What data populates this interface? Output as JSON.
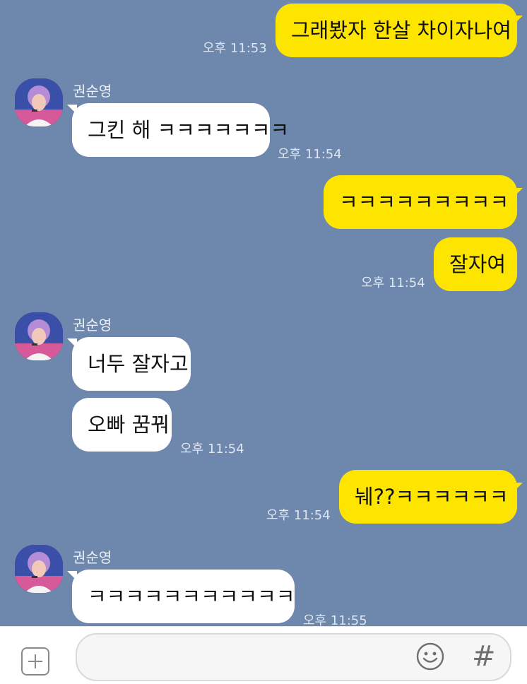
{
  "colors": {
    "background": "#6d87ad",
    "my_bubble": "#fde500",
    "their_bubble": "#ffffff"
  },
  "messages": [
    {
      "sender": "me",
      "text": "그래봤자 한살 차이자나여",
      "time": "오후 11:53"
    },
    {
      "sender": "권순영",
      "text": "그킨 해 ㅋㅋㅋㅋㅋㅋㅋ",
      "time": "오후 11:54"
    },
    {
      "sender": "me",
      "text": "ㅋㅋㅋㅋㅋㅋㅋㅋㅋ"
    },
    {
      "sender": "me",
      "text": "잘자여",
      "time": "오후 11:54"
    },
    {
      "sender": "권순영",
      "text": "너두 잘자고"
    },
    {
      "sender": "권순영",
      "text": "오빠 꿈꿔",
      "time": "오후 11:54"
    },
    {
      "sender": "me",
      "text": "눼??ㅋㅋㅋㅋㅋㅋ",
      "time": "오후 11:54"
    },
    {
      "sender": "권순영",
      "text": "ㅋㅋㅋㅋㅋㅋㅋㅋㅋㅋㅋ",
      "time": "오후 11:55"
    }
  ],
  "composer": {
    "add_icon": "plus-square-icon",
    "emoji_icon": "smiley-icon",
    "hash_icon": "hash-icon",
    "hash_glyph": "#",
    "input_value": ""
  }
}
